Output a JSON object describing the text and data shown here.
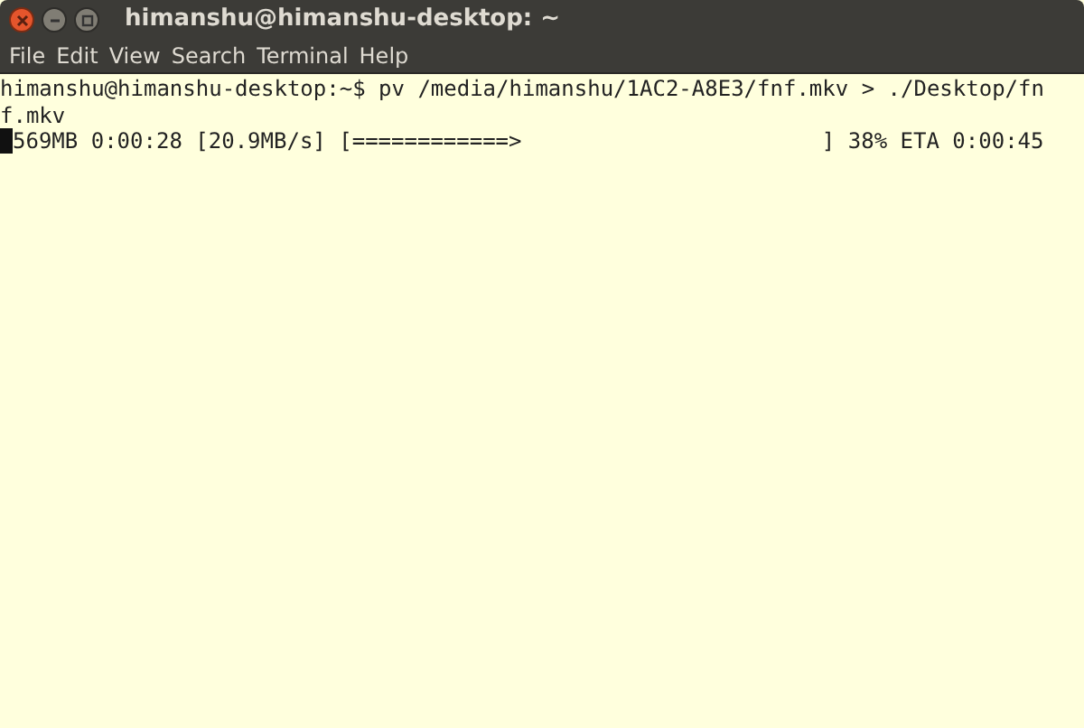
{
  "window": {
    "title": "himanshu@himanshu-desktop: ~"
  },
  "menu": [
    "File",
    "Edit",
    "View",
    "Search",
    "Terminal",
    "Help"
  ],
  "terminal": {
    "lines": [
      {
        "text": "himanshu@himanshu-desktop:~$ pv /media/himanshu/1AC2-A8E3/fnf.mkv > ./Desktop/fn",
        "cursor": false
      },
      {
        "text": "f.mkv",
        "cursor": false
      },
      {
        "text": "569MB 0:00:28 [20.9MB/s] [============>                       ] 38% ETA 0:00:45",
        "cursor": true
      }
    ]
  }
}
